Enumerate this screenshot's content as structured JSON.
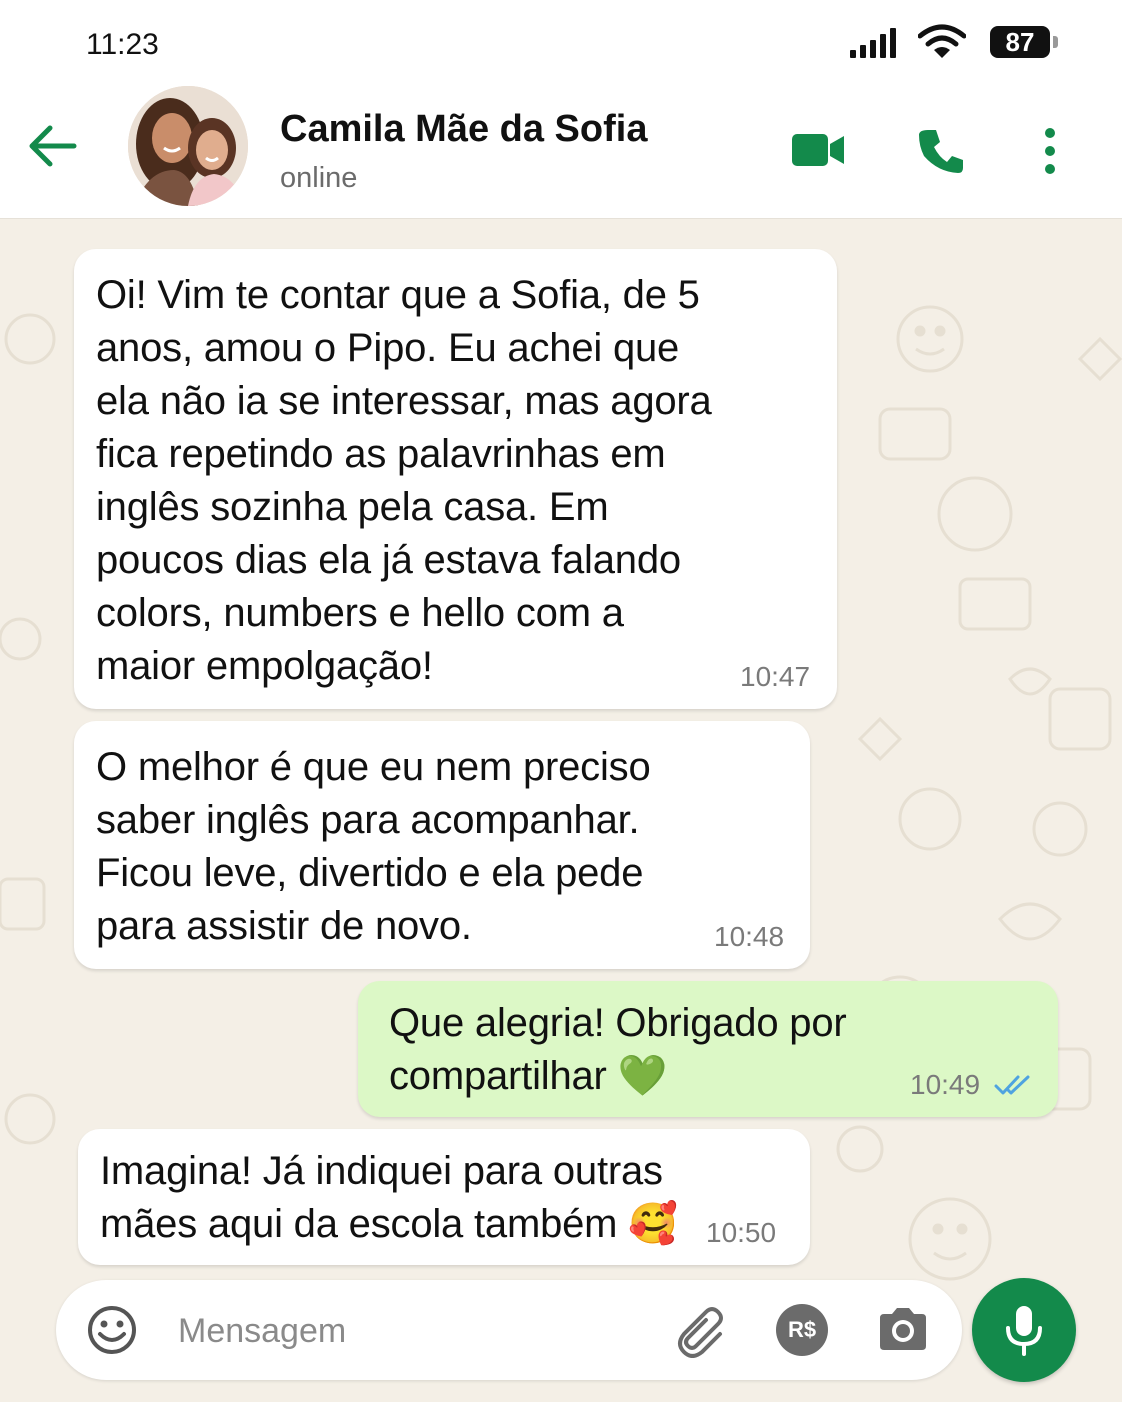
{
  "status_bar": {
    "time": "11:23",
    "battery": "87",
    "icons": [
      "signal-icon",
      "wifi-icon",
      "battery-icon"
    ]
  },
  "header": {
    "contact_name": "Camila Mãe da Sofia",
    "status": "online",
    "icons": [
      "back-arrow-icon",
      "avatar",
      "video-call-icon",
      "phone-icon",
      "more-options-icon"
    ]
  },
  "colors": {
    "accent": "#138a4b",
    "incoming_bubble": "#ffffff",
    "outgoing_bubble": "#dcf8c6",
    "chat_background": "#f4efe6",
    "read_ticks": "#4fa3e0"
  },
  "messages": [
    {
      "direction": "incoming",
      "text": "Oi! Vim te contar que a Sofia, de 5\nanos, amou o Pipo. Eu achei que\nela não ia se interessar, mas agora\nfica repetindo as palavrinhas em\ninglês sozinha pela casa. Em\npoucos dias ela já estava falando\ncolors, numbers e hello com a\nmaior empolgação!",
      "time": "10:47"
    },
    {
      "direction": "incoming",
      "text": "O melhor é que eu nem preciso\nsaber inglês para acompanhar.\nFicou leve, divertido e ela pede\npara assistir de novo.",
      "time": "10:48"
    },
    {
      "direction": "outgoing",
      "text": "Que alegria!  Obrigado por\ncompartilhar 💚",
      "time": "10:49",
      "status": "read"
    },
    {
      "direction": "incoming",
      "text": "Imagina!  Já indiquei para outras\nmães aqui da escola também 🥰",
      "time": "10:50"
    }
  ],
  "composer": {
    "placeholder": "Mensagem",
    "payment_label": "R$",
    "icons": [
      "emoji-icon",
      "attach-clip-icon",
      "payment-icon",
      "camera-icon",
      "microphone-icon"
    ]
  }
}
